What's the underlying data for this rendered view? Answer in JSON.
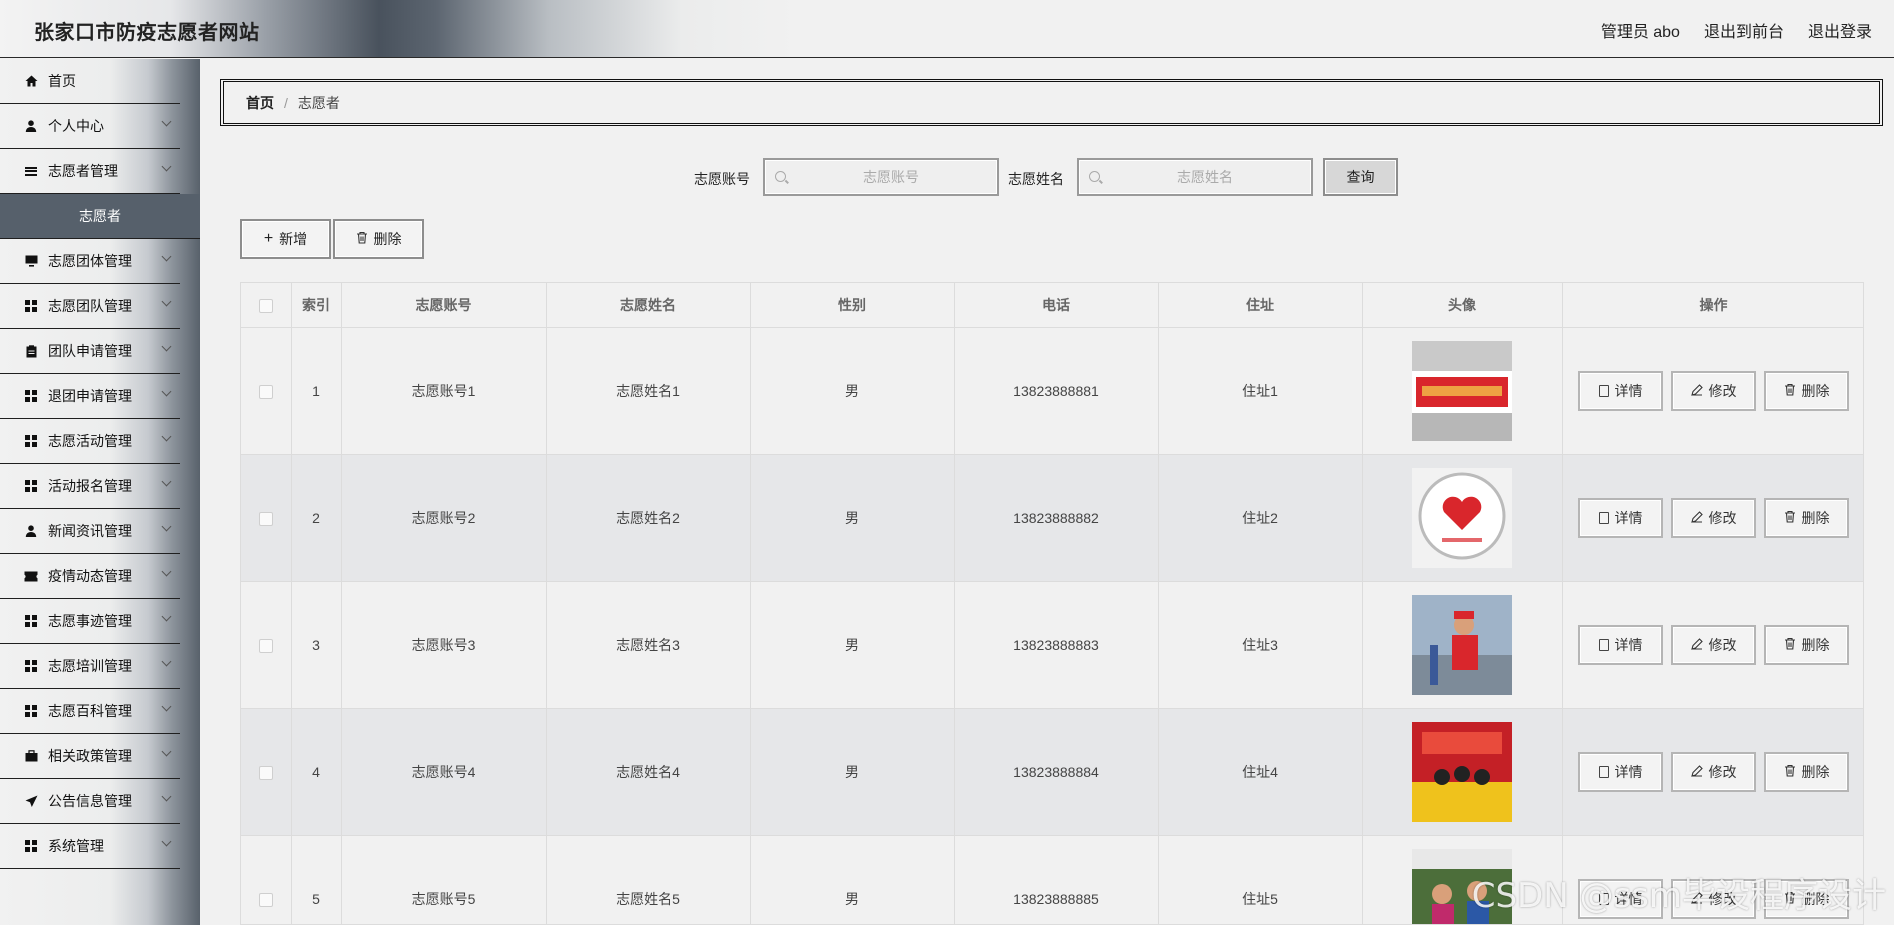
{
  "header": {
    "title": "张家口市防疫志愿者网站",
    "user": "管理员 abo",
    "to_front": "退出到前台",
    "logout": "退出登录"
  },
  "sidebar": {
    "items": [
      {
        "label": "首页",
        "icon": "home-icon",
        "expandable": false
      },
      {
        "label": "个人中心",
        "icon": "person-icon",
        "expandable": true
      },
      {
        "label": "志愿者管理",
        "icon": "list-icon",
        "expandable": true
      },
      {
        "label": "志愿者",
        "icon": "",
        "expandable": false,
        "sub": true
      },
      {
        "label": "志愿团体管理",
        "icon": "monitor-icon",
        "expandable": true
      },
      {
        "label": "志愿团队管理",
        "icon": "grid-icon",
        "expandable": true
      },
      {
        "label": "团队申请管理",
        "icon": "clipboard-icon",
        "expandable": true
      },
      {
        "label": "退团申请管理",
        "icon": "grid-icon",
        "expandable": true
      },
      {
        "label": "志愿活动管理",
        "icon": "grid-icon",
        "expandable": true
      },
      {
        "label": "活动报名管理",
        "icon": "grid-icon",
        "expandable": true
      },
      {
        "label": "新闻资讯管理",
        "icon": "person-icon",
        "expandable": true
      },
      {
        "label": "疫情动态管理",
        "icon": "ticket-icon",
        "expandable": true
      },
      {
        "label": "志愿事迹管理",
        "icon": "grid-icon",
        "expandable": true
      },
      {
        "label": "志愿培训管理",
        "icon": "grid-icon",
        "expandable": true
      },
      {
        "label": "志愿百科管理",
        "icon": "grid-icon",
        "expandable": true
      },
      {
        "label": "相关政策管理",
        "icon": "briefcase-icon",
        "expandable": true
      },
      {
        "label": "公告信息管理",
        "icon": "send-icon",
        "expandable": true
      },
      {
        "label": "系统管理",
        "icon": "grid-icon",
        "expandable": true
      }
    ]
  },
  "breadcrumb": {
    "home": "首页",
    "separator": "/",
    "current": "志愿者"
  },
  "search": {
    "account_label": "志愿账号",
    "account_placeholder": "志愿账号",
    "name_label": "志愿姓名",
    "name_placeholder": "志愿姓名",
    "query_button": "查询"
  },
  "toolbar": {
    "add_label": "新增",
    "delete_label": "删除"
  },
  "table": {
    "columns": [
      "索引",
      "志愿账号",
      "志愿姓名",
      "性别",
      "电话",
      "住址",
      "头像",
      "操作"
    ],
    "rows": [
      {
        "index": "1",
        "account": "志愿账号1",
        "name": "志愿姓名1",
        "gender": "男",
        "phone": "13823888881",
        "address": "住址1"
      },
      {
        "index": "2",
        "account": "志愿账号2",
        "name": "志愿姓名2",
        "gender": "男",
        "phone": "13823888882",
        "address": "住址2"
      },
      {
        "index": "3",
        "account": "志愿账号3",
        "name": "志愿姓名3",
        "gender": "男",
        "phone": "13823888883",
        "address": "住址3"
      },
      {
        "index": "4",
        "account": "志愿账号4",
        "name": "志愿姓名4",
        "gender": "男",
        "phone": "13823888884",
        "address": "住址4"
      },
      {
        "index": "5",
        "account": "志愿账号5",
        "name": "志愿姓名5",
        "gender": "男",
        "phone": "13823888885",
        "address": "住址5"
      }
    ],
    "actions": {
      "detail": "详情",
      "edit": "修改",
      "delete": "删除"
    }
  },
  "watermark": "CSDN @ssm毕设程序设计"
}
